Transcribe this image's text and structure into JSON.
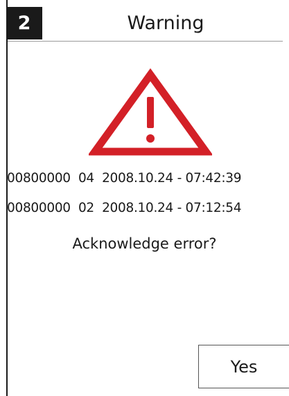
{
  "header": {
    "number": "2",
    "title": "Warning"
  },
  "icon": "warning-triangle-icon",
  "colors": {
    "warning": "#d32027",
    "text": "#1a1a1a"
  },
  "errors": [
    {
      "code": "00800000",
      "sub": "04",
      "timestamp": "2008.10.24 - 07:42:39"
    },
    {
      "code": "00800000",
      "sub": "02",
      "timestamp": "2008.10.24 - 07:12:54"
    }
  ],
  "question": "Acknowledge error?",
  "buttons": {
    "yes": "Yes"
  }
}
